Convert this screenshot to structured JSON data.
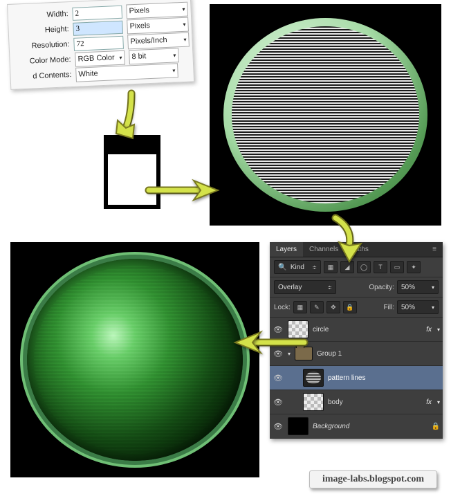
{
  "dialog": {
    "width_label": "Width:",
    "width_value": "2",
    "width_unit": "Pixels",
    "height_label": "Height:",
    "height_value": "3",
    "height_unit": "Pixels",
    "resolution_label": "Resolution:",
    "resolution_value": "72",
    "resolution_unit": "Pixels/Inch",
    "colormode_label": "Color Mode:",
    "colormode_value": "RGB Color",
    "colordepth_value": "8 bit",
    "contents_label": "d Contents:",
    "contents_value": "White"
  },
  "panel": {
    "tab_layers": "Layers",
    "tab_channels": "Channels",
    "tab_paths": "Paths",
    "kind_label": "Kind",
    "blend_mode": "Overlay",
    "opacity_label": "Opacity:",
    "opacity_value": "50%",
    "lock_label": "Lock:",
    "fill_label": "Fill:",
    "fill_value": "50%",
    "filter_icons": [
      "▦",
      "◢",
      "◯",
      "T",
      "▭",
      "✦"
    ],
    "lock_icons": [
      "▦",
      "✎",
      "✥",
      "🔒"
    ],
    "layers": [
      {
        "name": "circle",
        "fx": "fx"
      },
      {
        "name": "Group 1"
      },
      {
        "name": "pattern lines"
      },
      {
        "name": "body",
        "fx": "fx"
      },
      {
        "name": "Background"
      }
    ]
  },
  "footer": "image-labs.blogspot.com"
}
